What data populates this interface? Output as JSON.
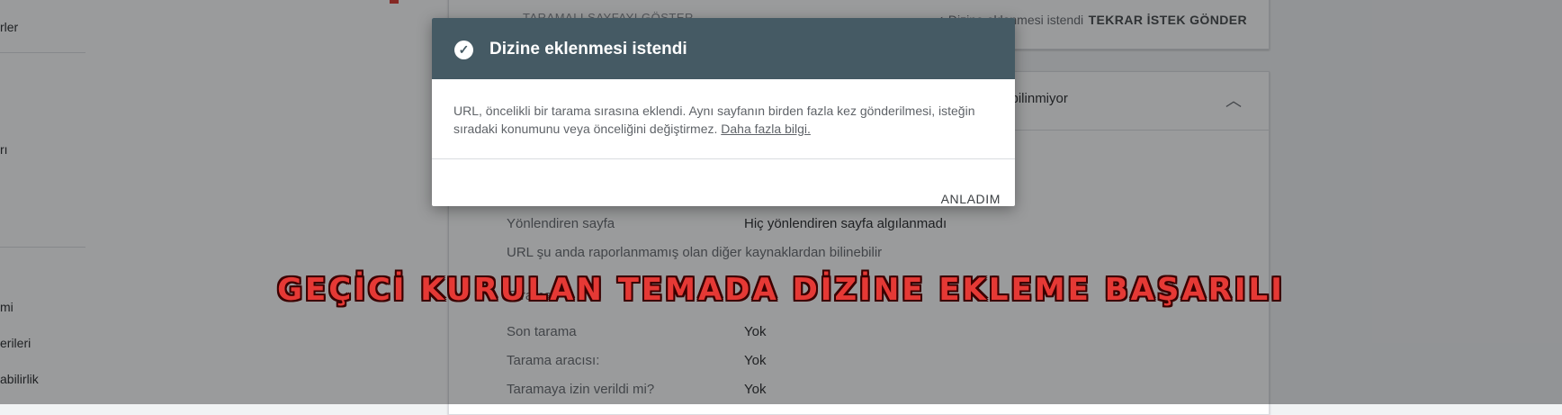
{
  "sidebar": {
    "items": [
      {
        "label": "rler"
      },
      {
        "label": "rı"
      },
      {
        "label": "mi"
      },
      {
        "label": "erileri"
      },
      {
        "label": "abilirlik"
      }
    ]
  },
  "card_top": {
    "left_text": "TARAMALI SAYFAYI GÖSTER",
    "status": "Dizine eklenmesi istendi",
    "resend": "TEKRAR İSTEK GÖNDER"
  },
  "card_main": {
    "header_text": "n bilinmiyor",
    "rows": [
      {
        "label": "Yönlendiren sayfa",
        "value": "Hiç yönlendiren sayfa algılanmadı"
      }
    ],
    "note": "URL şu anda raporlanmamış olan diğer kaynaklardan bilinebilir",
    "section_label": "Tarama",
    "crawl_rows": [
      {
        "label": "Son tarama",
        "value": "Yok"
      },
      {
        "label": "Tarama aracısı:",
        "value": "Yok"
      },
      {
        "label": "Taramaya izin verildi mi?",
        "value": "Yok"
      }
    ]
  },
  "dialog": {
    "icon": "check-circle-icon",
    "title": "Dizine eklenmesi istendi",
    "body": "URL, öncelikli bir tarama sırasına eklendi. Aynı sayfanın birden fazla kez gönderilmesi, isteğin sıradaki konumunu veya önceliğini değiştirmez.",
    "link": "Daha fazla bilgi.",
    "ok_label": "ANLADIM"
  },
  "banner": {
    "text": "GEÇİCİ KURULAN TEMADA DİZİNE EKLEME BAŞARILI"
  },
  "colors": {
    "dialog_header": "#455a64",
    "banner_fill": "#e53935",
    "overlay": "rgba(32,33,36,0.45)"
  }
}
